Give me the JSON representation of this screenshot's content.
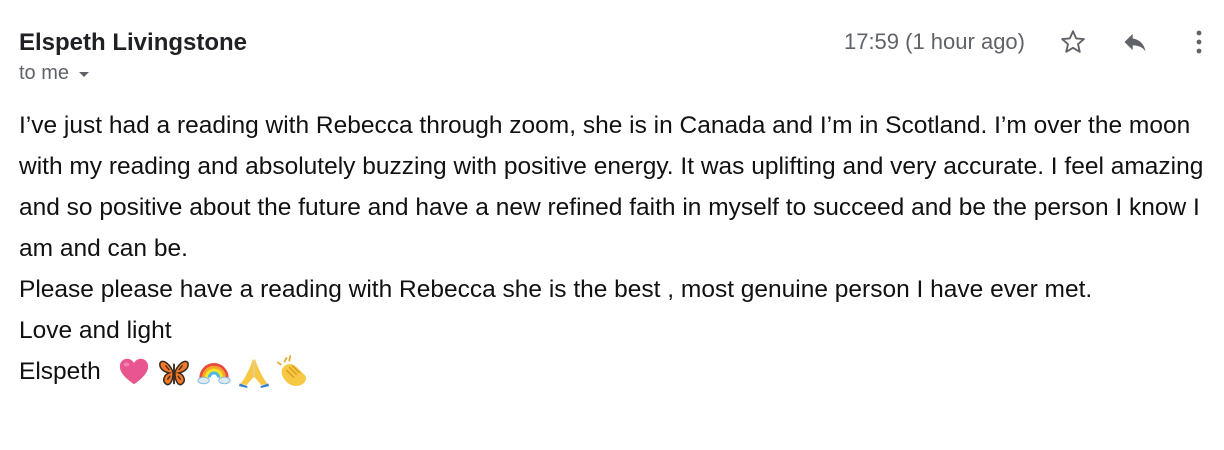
{
  "header": {
    "sender_name": "Elspeth Livingstone",
    "recipient_label": "to me",
    "timestamp": "17:59 (1 hour ago)"
  },
  "actions": {
    "star_icon": "star-outline-icon",
    "reply_icon": "reply-arrow-icon",
    "more_icon": "vertical-dots-icon"
  },
  "message": {
    "paragraph_1": "I’ve just had a reading with Rebecca through zoom, she is in Canada and I’m in Scotland. I’m over the moon with my reading and absolutely buzzing with positive energy. It was uplifting and very accurate. I feel amazing and so positive about the future and have a new refined faith in myself to succeed and be the person I know I am and can be.",
    "paragraph_2": "Please please have a reading with Rebecca she is the best , most genuine person I have ever met.",
    "closing": "Love and light",
    "signature_name": "Elspeth",
    "emojis": [
      "heart",
      "butterfly",
      "rainbow",
      "folded-hands",
      "clapping-hands"
    ]
  },
  "colors": {
    "sender": "#202124",
    "secondary_text": "#5f6368",
    "body_text": "#111111",
    "heart": "#e8558f",
    "butterfly": "#f0792a",
    "hands": "#f7c843"
  }
}
